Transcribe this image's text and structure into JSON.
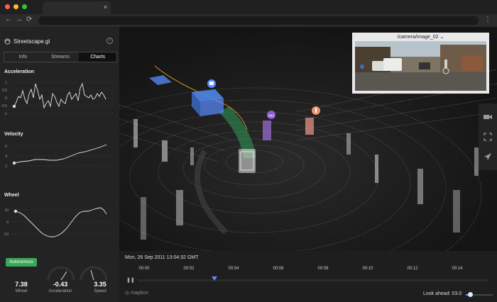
{
  "browser": {
    "menu_dots": "⋮",
    "tab_close": "×",
    "nav": {
      "back": "←",
      "forward": "→",
      "reload": "⟳"
    }
  },
  "sidebar": {
    "app_name": "Streetscape.gl",
    "info_icon": "i",
    "tabs": [
      {
        "label": "Info"
      },
      {
        "label": "Streams"
      },
      {
        "label": "Charts",
        "active": true
      }
    ],
    "charts": [
      {
        "title": "Acceleration",
        "y_ticks": [
          "1",
          "0.5",
          "0",
          "-0.5",
          "-1"
        ]
      },
      {
        "title": "Velocity",
        "y_ticks": [
          "6",
          "4",
          "2"
        ]
      },
      {
        "title": "Wheel",
        "y_ticks": [
          "10",
          "0",
          "-10"
        ]
      }
    ],
    "status": {
      "badge": "Autonomous",
      "metrics": [
        {
          "value": "7.38",
          "label": "Wheel"
        },
        {
          "value": "-0.43",
          "label": "Acceleration"
        },
        {
          "value": "3.35",
          "label": "Speed"
        }
      ]
    }
  },
  "camera": {
    "title": "/camera/image_02",
    "caret": "⌄"
  },
  "timeline": {
    "date": "Mon, 26 Sep 2011 13:04:32 GMT",
    "ticks": [
      "00:00",
      "00:02",
      "00:04",
      "00:06",
      "00:08",
      "00:10",
      "00:12",
      "00:14"
    ],
    "pause_glyph": "❚❚",
    "mapbox": "mapbox",
    "look_ahead_label": "Look ahead: 03.0",
    "look_ahead_level": 0.15
  },
  "colors": {
    "accent_blue": "#5b8cff",
    "autonomous_green": "#3ca75a",
    "path_green": "#2f9c56"
  }
}
